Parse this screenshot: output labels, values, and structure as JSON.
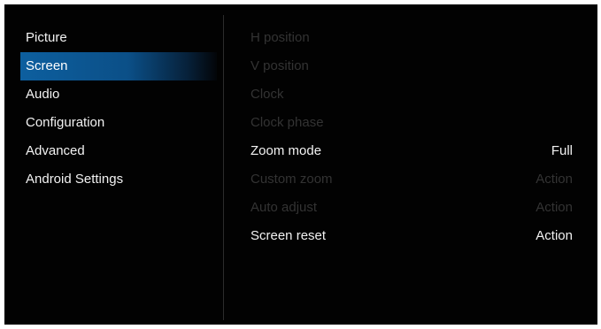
{
  "left_menu": {
    "items": [
      {
        "label": "Picture"
      },
      {
        "label": "Screen"
      },
      {
        "label": "Audio"
      },
      {
        "label": "Configuration"
      },
      {
        "label": "Advanced"
      },
      {
        "label": "Android Settings"
      }
    ],
    "selected": "Screen"
  },
  "screen_settings": {
    "items": [
      {
        "label": "H position",
        "value": "",
        "enabled": false
      },
      {
        "label": "V position",
        "value": "",
        "enabled": false
      },
      {
        "label": "Clock",
        "value": "",
        "enabled": false
      },
      {
        "label": "Clock phase",
        "value": "",
        "enabled": false
      },
      {
        "label": "Zoom mode",
        "value": "Full",
        "enabled": true
      },
      {
        "label": "Custom zoom",
        "value": "Action",
        "enabled": false
      },
      {
        "label": "Auto adjust",
        "value": "Action",
        "enabled": false
      },
      {
        "label": "Screen reset",
        "value": "Action",
        "enabled": true
      }
    ]
  },
  "colors": {
    "background": "#020202",
    "text": "#f2f2f2",
    "disabled_text": "#333333",
    "selection": "#0d5f9f",
    "divider": "#2b2b2b"
  }
}
